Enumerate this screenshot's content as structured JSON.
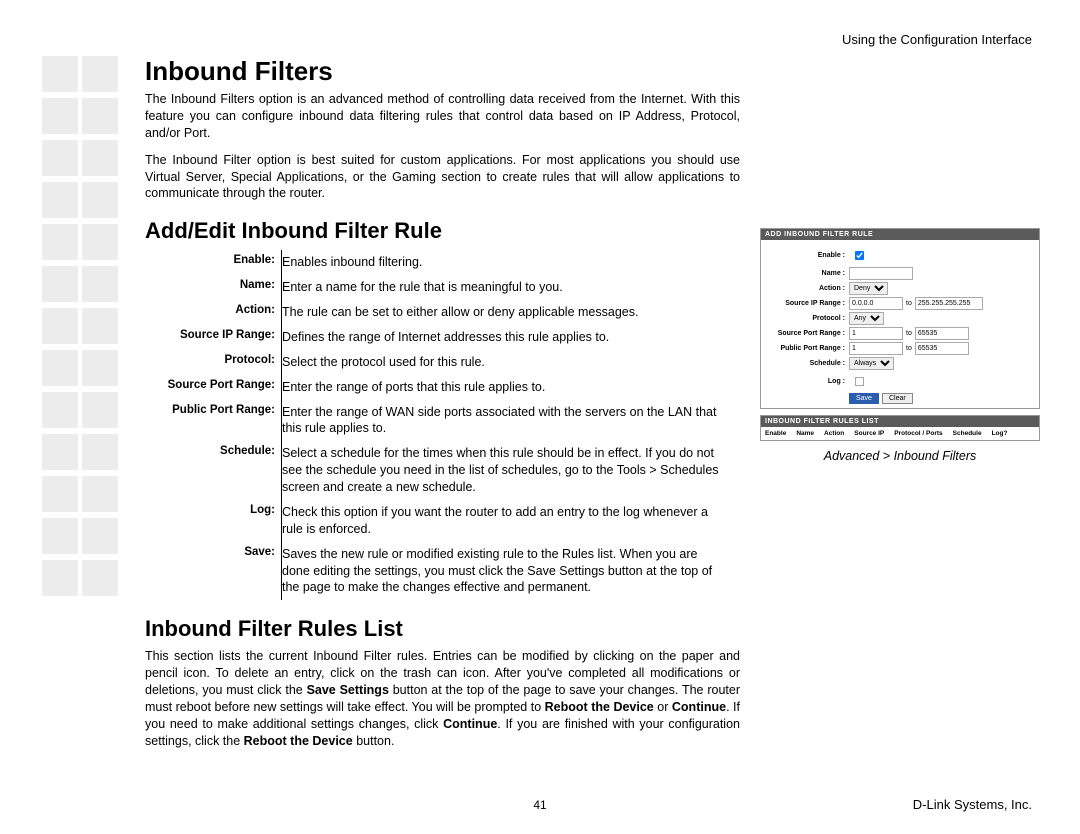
{
  "header": {
    "right": "Using the Configuration Interface"
  },
  "footer": {
    "page": "41",
    "right": "D-Link Systems, Inc."
  },
  "h1": "Inbound Filters",
  "p1": "The Inbound Filters option is an advanced method of controlling data received from the Internet. With this feature you can configure inbound data filtering rules that control data based on IP Address, Protocol, and/or Port.",
  "p2": "The Inbound Filter option is best suited for custom applications. For most applications you should use Virtual Server, Special Applications, or the Gaming section to create rules that will allow applications to communicate through the router.",
  "h2a": "Add/Edit Inbound Filter Rule",
  "defs": [
    {
      "label": "Enable:",
      "value": "Enables inbound filtering."
    },
    {
      "label": "Name:",
      "value": "Enter a name for the rule that is meaningful to you."
    },
    {
      "label": "Action:",
      "value": "The rule can be set to either allow or deny applicable messages."
    },
    {
      "label": "Source IP Range:",
      "value": "Defines the range of Internet addresses this rule applies to."
    },
    {
      "label": "Protocol:",
      "value": "Select the protocol used for this rule."
    },
    {
      "label": "Source Port Range:",
      "value": "Enter the range of ports that this rule applies to."
    },
    {
      "label": "Public Port Range:",
      "value": "Enter the range of WAN side ports associated with the servers on the LAN that this rule applies to."
    },
    {
      "label": "Schedule:",
      "value": "Select a schedule for the times when this rule should be in effect. If you do not see the schedule you need in the list of schedules, go to the Tools > Schedules screen and create a new schedule."
    },
    {
      "label": "Log:",
      "value": "Check this option if you want the router to add an entry to the log whenever a rule is enforced."
    },
    {
      "label": "Save:",
      "value": "Saves the new rule or modified existing rule to the Rules list. When you are done editing the settings, you must click the Save Settings button at the top of the page to make the changes effective and permanent."
    }
  ],
  "h2b": "Inbound Filter Rules List",
  "p3_parts": {
    "t1": "This section lists the current Inbound Filter rules. Entries can be modified by clicking on the paper and pencil icon. To delete an entry, click on the trash can icon. After you've completed all modifications or deletions, you must click the ",
    "b1": "Save Settings",
    "t2": " button at the top of the page to save your changes. The router must reboot before new settings will take effect. You will be prompted to ",
    "b2": "Reboot the Device",
    "t3": " or ",
    "b3": "Continue",
    "t4": ". If you need to make additional settings changes, click ",
    "b4": "Continue",
    "t5": ". If you are finished with your configuration settings, click the ",
    "b5": "Reboot the Device",
    "t6": " button."
  },
  "shot": {
    "title1": "ADD INBOUND FILTER RULE",
    "rows": {
      "enable": "Enable :",
      "name": "Name :",
      "action": "Action :",
      "action_val": "Deny",
      "srcip": "Source IP Range :",
      "srcip_from": "0.0.0.0",
      "srcip_to": "255.255.255.255",
      "proto": "Protocol :",
      "proto_val": "Any",
      "srcport": "Source Port Range :",
      "portfrom": "1",
      "portto": "65535",
      "pubport": "Public Port Range :",
      "sched": "Schedule :",
      "sched_val": "Always",
      "log": "Log :",
      "save_btn": "Save",
      "clear_btn": "Clear"
    },
    "title2": "INBOUND FILTER RULES LIST",
    "cols": [
      "Enable",
      "Name",
      "Action",
      "Source IP",
      "Protocol / Ports",
      "Schedule",
      "Log?"
    ],
    "caption": "Advanced > Inbound Filters"
  }
}
